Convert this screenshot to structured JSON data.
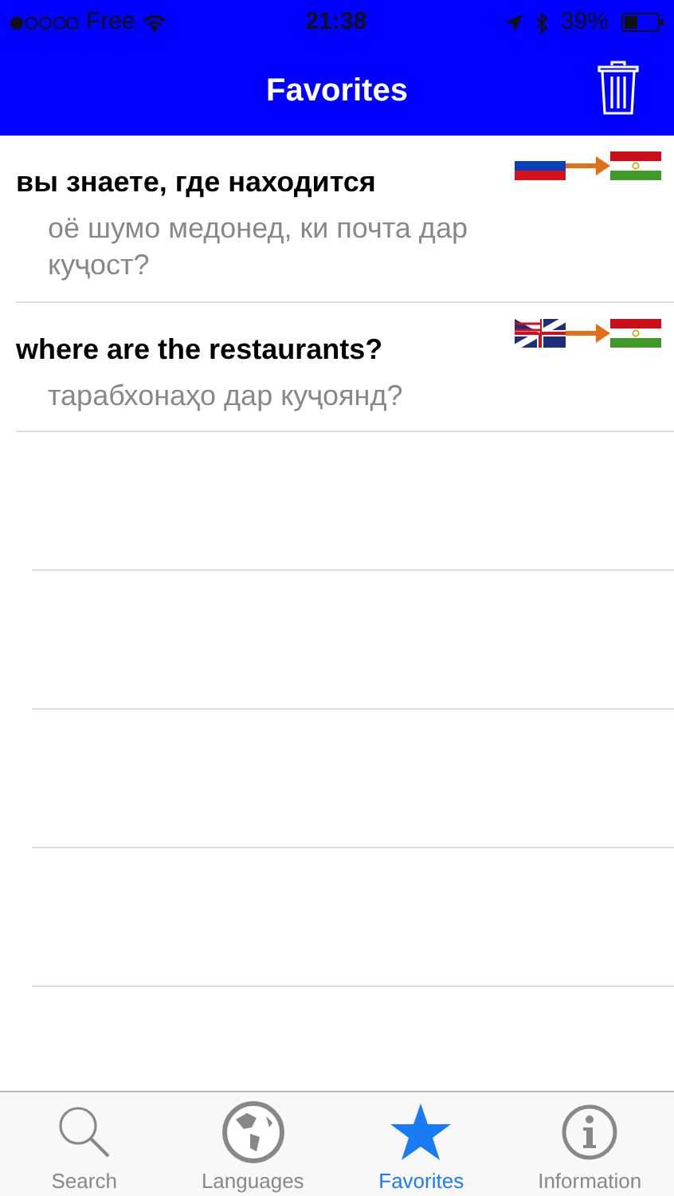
{
  "status_bar": {
    "carrier": "Free",
    "time": "21:38",
    "battery": "39%"
  },
  "nav_bar": {
    "title": "Favorites"
  },
  "favorites": [
    {
      "phrase": "вы знаете, где находится",
      "translation": "оё шумо медонед, ки почта дар куҷост?",
      "flags": [
        {
          "kind": "russia"
        },
        {
          "kind": "tajikistan"
        }
      ]
    },
    {
      "phrase": "where are the restaurants?",
      "translation": "тарабхонаҳо дар куҷоянд?",
      "flags": [
        {
          "kind": "uk_us"
        },
        {
          "kind": "tajikistan"
        }
      ]
    }
  ],
  "tabs": [
    {
      "label": "Search",
      "kind": "search",
      "selected": false
    },
    {
      "label": "Languages",
      "kind": "globe",
      "selected": false
    },
    {
      "label": "Favorites",
      "kind": "star",
      "selected": true
    },
    {
      "label": "Information",
      "kind": "info",
      "selected": false
    }
  ]
}
